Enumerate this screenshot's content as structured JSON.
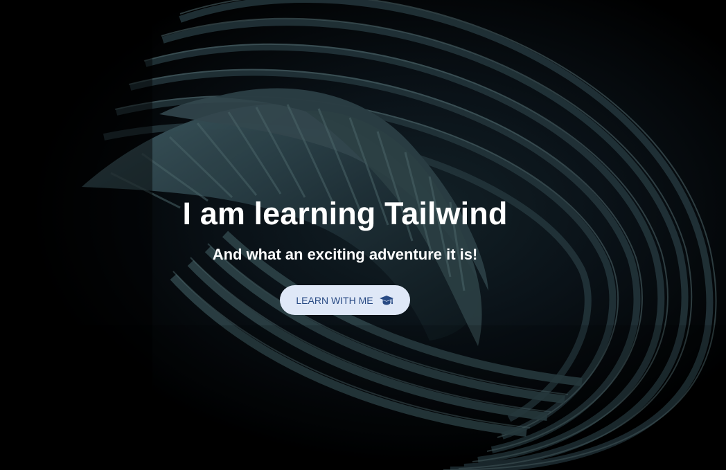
{
  "hero": {
    "title": "I am learning Tailwind",
    "subtitle": "And what an exciting adventure it is!",
    "button_label": "LEARN WITH ME",
    "button_icon": "graduation-cap-icon",
    "colors": {
      "background": "#000000",
      "title": "#ffffff",
      "button_background": "#dfe8f7",
      "button_text": "#284a84",
      "art": "#2f4a52"
    }
  }
}
